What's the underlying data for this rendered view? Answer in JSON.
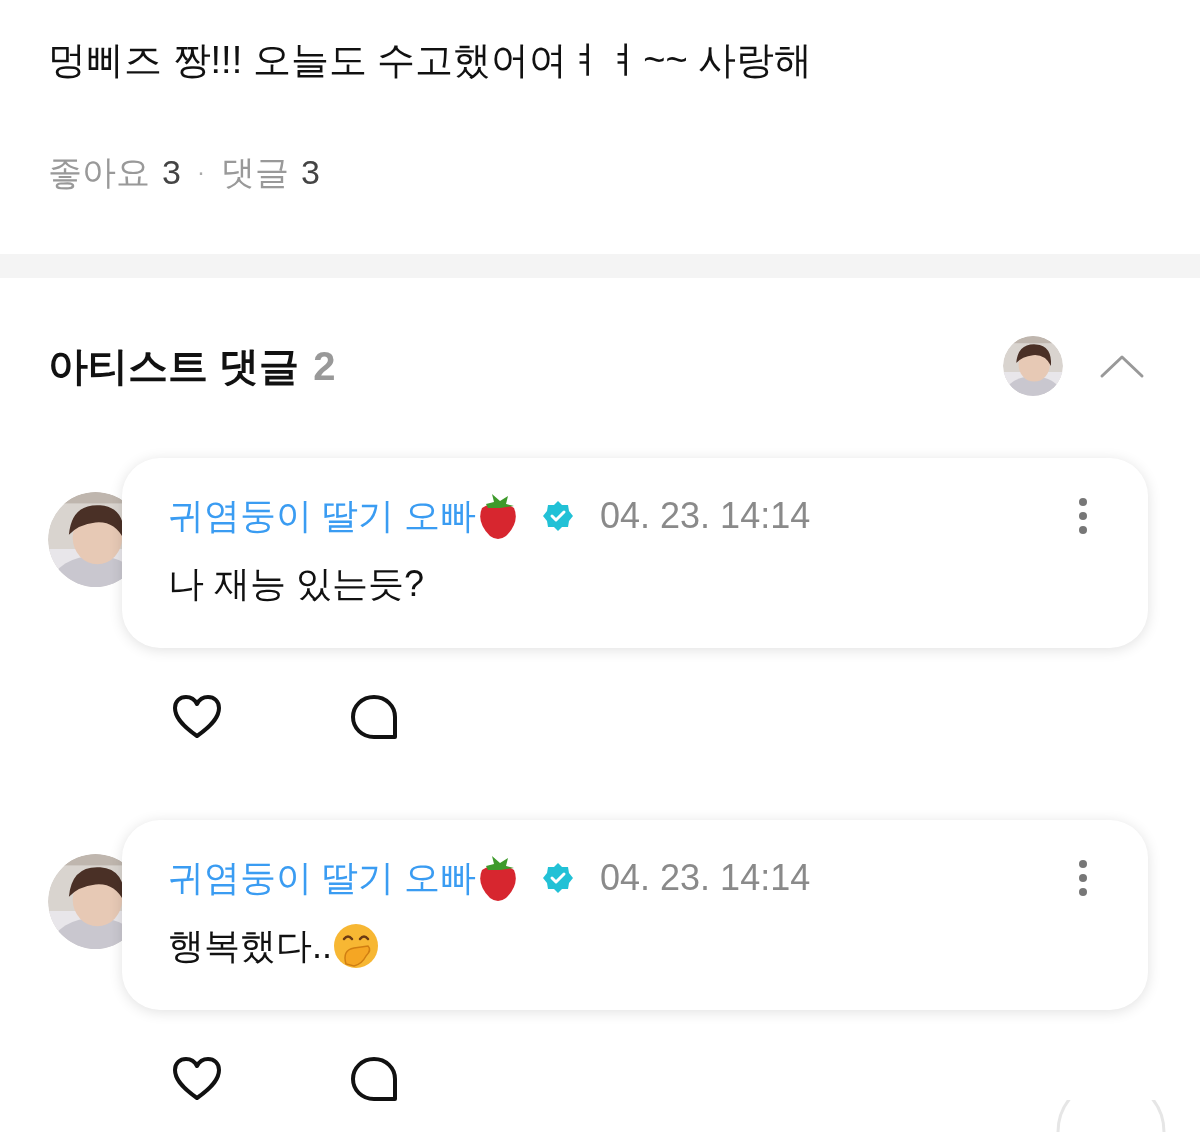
{
  "post": {
    "text": "멍삐즈 짱!!! 오늘도 수고했어여ㅕㅕ~~ 사랑해",
    "likes_label": "좋아요",
    "likes_count": "3",
    "separator": "·",
    "comments_label": "댓글",
    "comments_count": "3"
  },
  "artist_comments": {
    "title": "아티스트 댓글",
    "count": "2",
    "expanded": true,
    "comments": [
      {
        "author": "귀염둥이 딸기 오빠",
        "verified": true,
        "time": "04. 23. 14:14",
        "body": "나 재능 있는듯?",
        "body_emoji": false
      },
      {
        "author": "귀염둥이 딸기 오빠",
        "verified": true,
        "time": "04. 23. 14:14",
        "body": "행복했다..",
        "body_emoji": true
      }
    ]
  }
}
